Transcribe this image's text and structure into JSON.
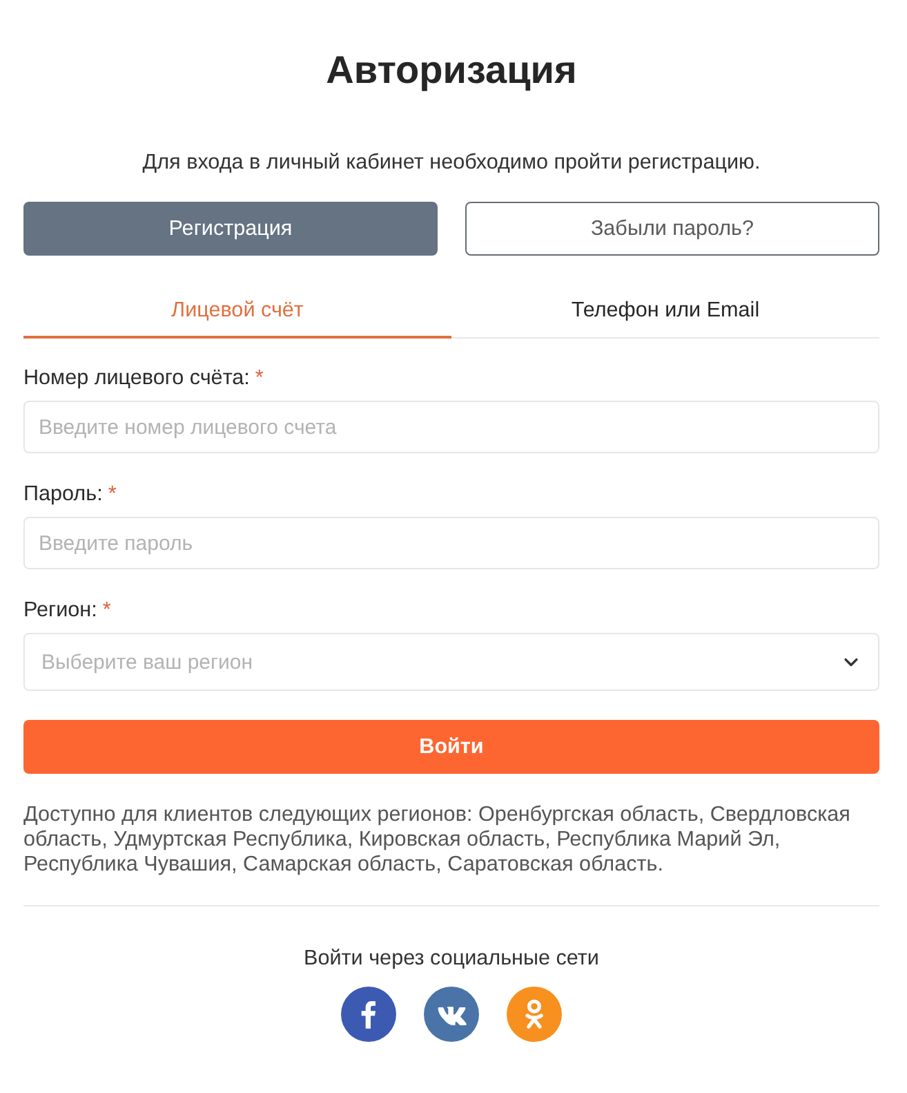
{
  "title": "Авторизация",
  "subtitle": "Для входа в личный кабинет необходимо пройти регистрацию.",
  "actions": [
    {
      "label": "Регистрация",
      "kind": "filled"
    },
    {
      "label": "Забыли пароль?",
      "kind": "outline"
    }
  ],
  "tabs": [
    {
      "label": "Лицевой счёт",
      "selected": true
    },
    {
      "label": "Телефон или Email",
      "selected": false
    }
  ],
  "fields": [
    {
      "label": "Номер лицевого счёта:",
      "required_mark": "*",
      "placeholder": "Введите номер лицевого счета",
      "kind": "text"
    },
    {
      "label": "Пароль:",
      "required_mark": "*",
      "placeholder": "Введите пароль",
      "kind": "password"
    },
    {
      "label": "Регион:",
      "required_mark": "*",
      "placeholder": "Выберите ваш регион",
      "kind": "select"
    }
  ],
  "submit": {
    "label": "Войти"
  },
  "note": "Доступно для клиентов следующих регионов: Оренбургская область, Свердловская область, Удмуртская Республика, Кировская область, Республика Марий Эл, Республика Чувашия, Самарская область, Саратовская область.",
  "social": {
    "heading": "Войти через социальные сети",
    "networks": [
      {
        "kind": "facebook"
      },
      {
        "kind": "vk"
      },
      {
        "kind": "ok"
      }
    ]
  }
}
